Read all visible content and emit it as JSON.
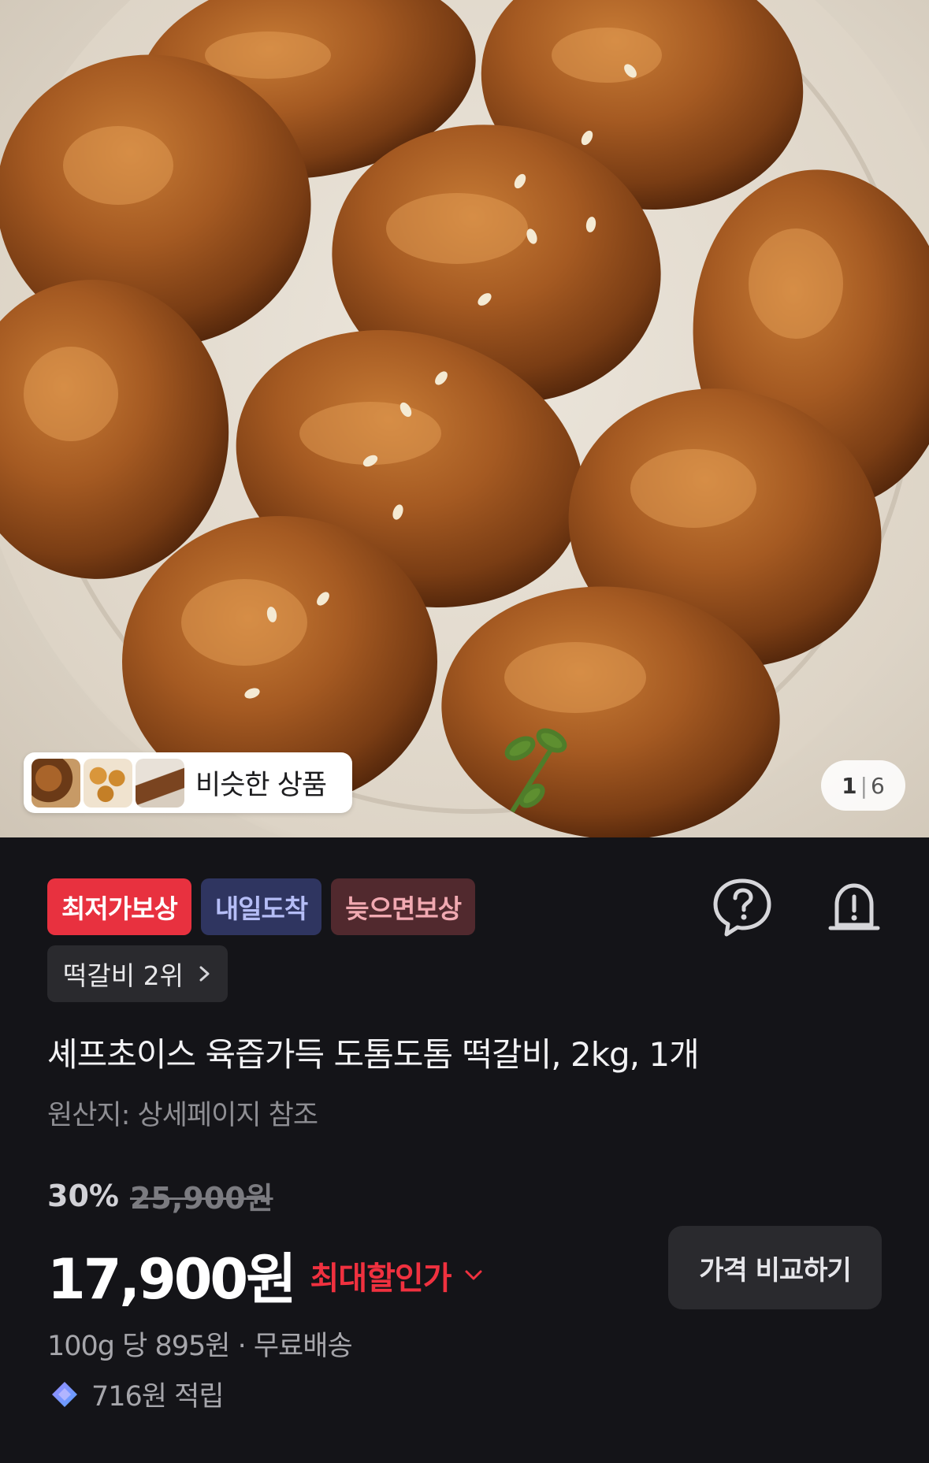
{
  "hero": {
    "image_alt_icon": "meat-patties-photo",
    "similar_products_label": "비슷한 상품",
    "page_current": "1",
    "page_total": "6"
  },
  "badges": {
    "lowest_price": "최저가보상",
    "tomorrow_arrival": "내일도착",
    "late_compensation": "늦으면보상"
  },
  "icons": {
    "help": "question-bubble-icon",
    "alert": "alarm-bell-icon"
  },
  "rank": {
    "label": "떡갈비 2위"
  },
  "product": {
    "title": "셰프초이스 육즙가득 도톰도톰 떡갈비, 2kg, 1개",
    "origin": "원산지: 상세페이지 참조"
  },
  "pricing": {
    "discount_rate": "30%",
    "original_price": "25,900원",
    "sale_price": "17,900원",
    "max_discount_label": "최대할인가",
    "compare_button": "가격 비교하기",
    "unit_price_shipping": "100g 당 895원 · 무료배송",
    "reward": "716원 적립"
  },
  "colors": {
    "background": "#141418",
    "accent_red": "#e8313f",
    "badge_navy": "#2f3560",
    "badge_maroon": "#51292e"
  }
}
